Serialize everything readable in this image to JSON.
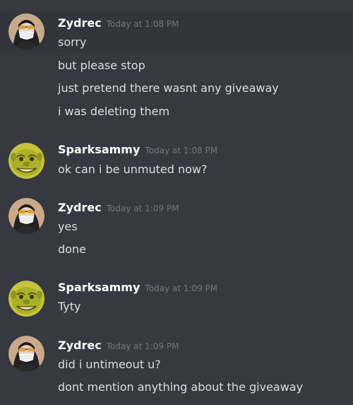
{
  "messages": [
    {
      "author": "Zydrec",
      "timestamp": "Today at 1:08 PM",
      "lines": [
        "sorry",
        "but please stop",
        "just pretend there wasnt any giveaway",
        "i was deleting them"
      ]
    },
    {
      "author": "Sparksammy",
      "timestamp": "Today at 1:08 PM",
      "lines": [
        "ok can i be unmuted now?"
      ]
    },
    {
      "author": "Zydrec",
      "timestamp": "Today at 1:09 PM",
      "lines": [
        "yes",
        "done"
      ]
    },
    {
      "author": "Sparksammy",
      "timestamp": "Today at 1:09 PM",
      "lines": [
        "Tyty"
      ]
    },
    {
      "author": "Zydrec",
      "timestamp": "Today at 1:09 PM",
      "lines": [
        "did i untimeout u?",
        "dont mention anything about the giveaway"
      ]
    }
  ],
  "colors": {
    "background": "#36393f",
    "username": "#ffffff",
    "message_text": "#dcddde",
    "timestamp": "#72767d"
  },
  "icons": {
    "zydrec_avatar": "masked-person-avatar-icon",
    "sparksammy_avatar": "shrek-face-avatar-icon"
  }
}
